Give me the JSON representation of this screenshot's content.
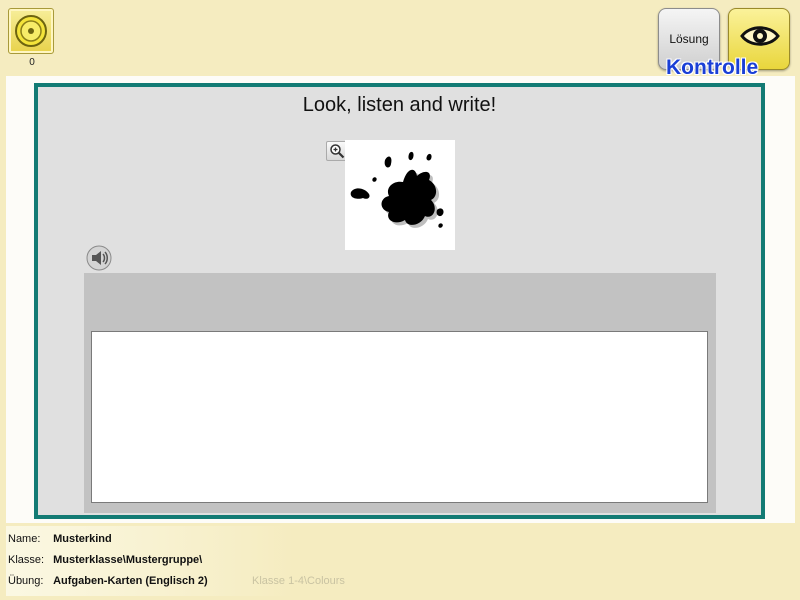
{
  "toolbar": {
    "coin_count": "0",
    "solution_label": "Lösung",
    "check_label": "Kontrolle",
    "icons": {
      "coin": "coin-icon",
      "eye": "eye-icon"
    }
  },
  "exercise": {
    "title": "Look, listen and write!",
    "icons": {
      "zoom": "zoom-in-icon",
      "speaker": "speaker-icon",
      "picture": "ink-splat-picture"
    },
    "answer_value": ""
  },
  "footer": {
    "name_label": "Name:",
    "name_value": "Musterkind",
    "class_label": "Klasse:",
    "class_value": "Musterklasse\\Mustergruppe\\",
    "exercise_label": "Übung:",
    "exercise_value": "Aufgaben-Karten (Englisch 2)",
    "path_hint": "Klasse 1-4\\Colours"
  },
  "colors": {
    "background": "#f5ecc0",
    "card_border": "#137b74",
    "check_text": "#1a3fd6"
  }
}
